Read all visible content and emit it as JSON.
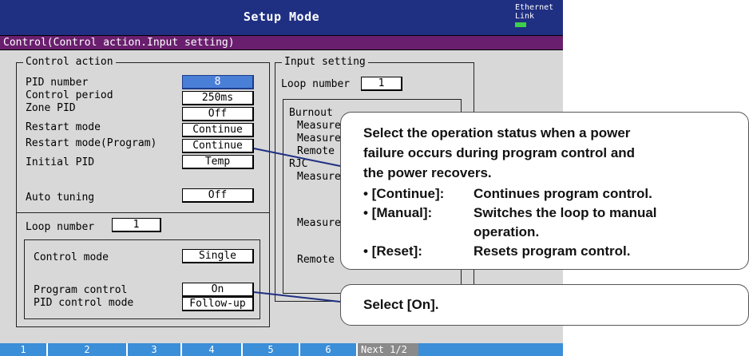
{
  "header": {
    "title": "Setup Mode",
    "ethernet_label_1": "Ethernet",
    "ethernet_label_2": "Link",
    "link_led_color": "#3dd04a"
  },
  "breadcrumb": "Control(Control action.Input setting)",
  "control_action": {
    "title": "Control action",
    "rows": [
      {
        "label": "PID number",
        "value": "8"
      },
      {
        "label": "Control period",
        "value": "250ms"
      },
      {
        "label": "Zone PID",
        "value": "Off"
      },
      {
        "label": "Restart mode",
        "value": "Continue"
      },
      {
        "label": "Restart mode(Program)",
        "value": "Continue"
      },
      {
        "label": "Initial PID",
        "value": "Temp"
      }
    ],
    "auto_tuning": {
      "label": "Auto tuning",
      "value": "Off"
    },
    "loop": {
      "label": "Loop number",
      "value": "1",
      "control_mode": {
        "label": "Control mode",
        "value": "Single"
      },
      "program_control": {
        "label": "Program control",
        "value": "On"
      },
      "pid_control_mode": {
        "label": "PID control mode",
        "value": "Follow-up"
      }
    }
  },
  "input_setting": {
    "title": "Input setting",
    "loop_label": "Loop number",
    "loop_value": "1",
    "burnout": "Burnout",
    "measure_1": "Measure",
    "measure_2": "Measure",
    "remote_1": "Remote",
    "rjc": "RJC",
    "measure_3": "Measure",
    "measure_4": "Measure",
    "remote_2": "Remote"
  },
  "softkeys": [
    "1",
    "2",
    "3",
    "4",
    "5",
    "6",
    "Next 1/2"
  ],
  "callouts": {
    "restart_note": {
      "line1": "Select the operation status when a power",
      "line2": "failure occurs during program control and",
      "line3": "the power recovers.",
      "continue_key": "• [Continue]:",
      "continue_desc": "Continues program control.",
      "manual_key": "• [Manual]:",
      "manual_desc": "Switches the loop to manual",
      "manual_desc2": "operation.",
      "reset_key": "• [Reset]:",
      "reset_desc": "Resets program control."
    },
    "program_note": "Select [On]."
  },
  "colors": {
    "title_bar": "#1f2f82",
    "breadcrumb_bar": "#6a1f6e",
    "selected_field": "#4a7fd8",
    "softkey_bar": "#3b8ed8",
    "panel_bg": "#d8d8d8"
  }
}
